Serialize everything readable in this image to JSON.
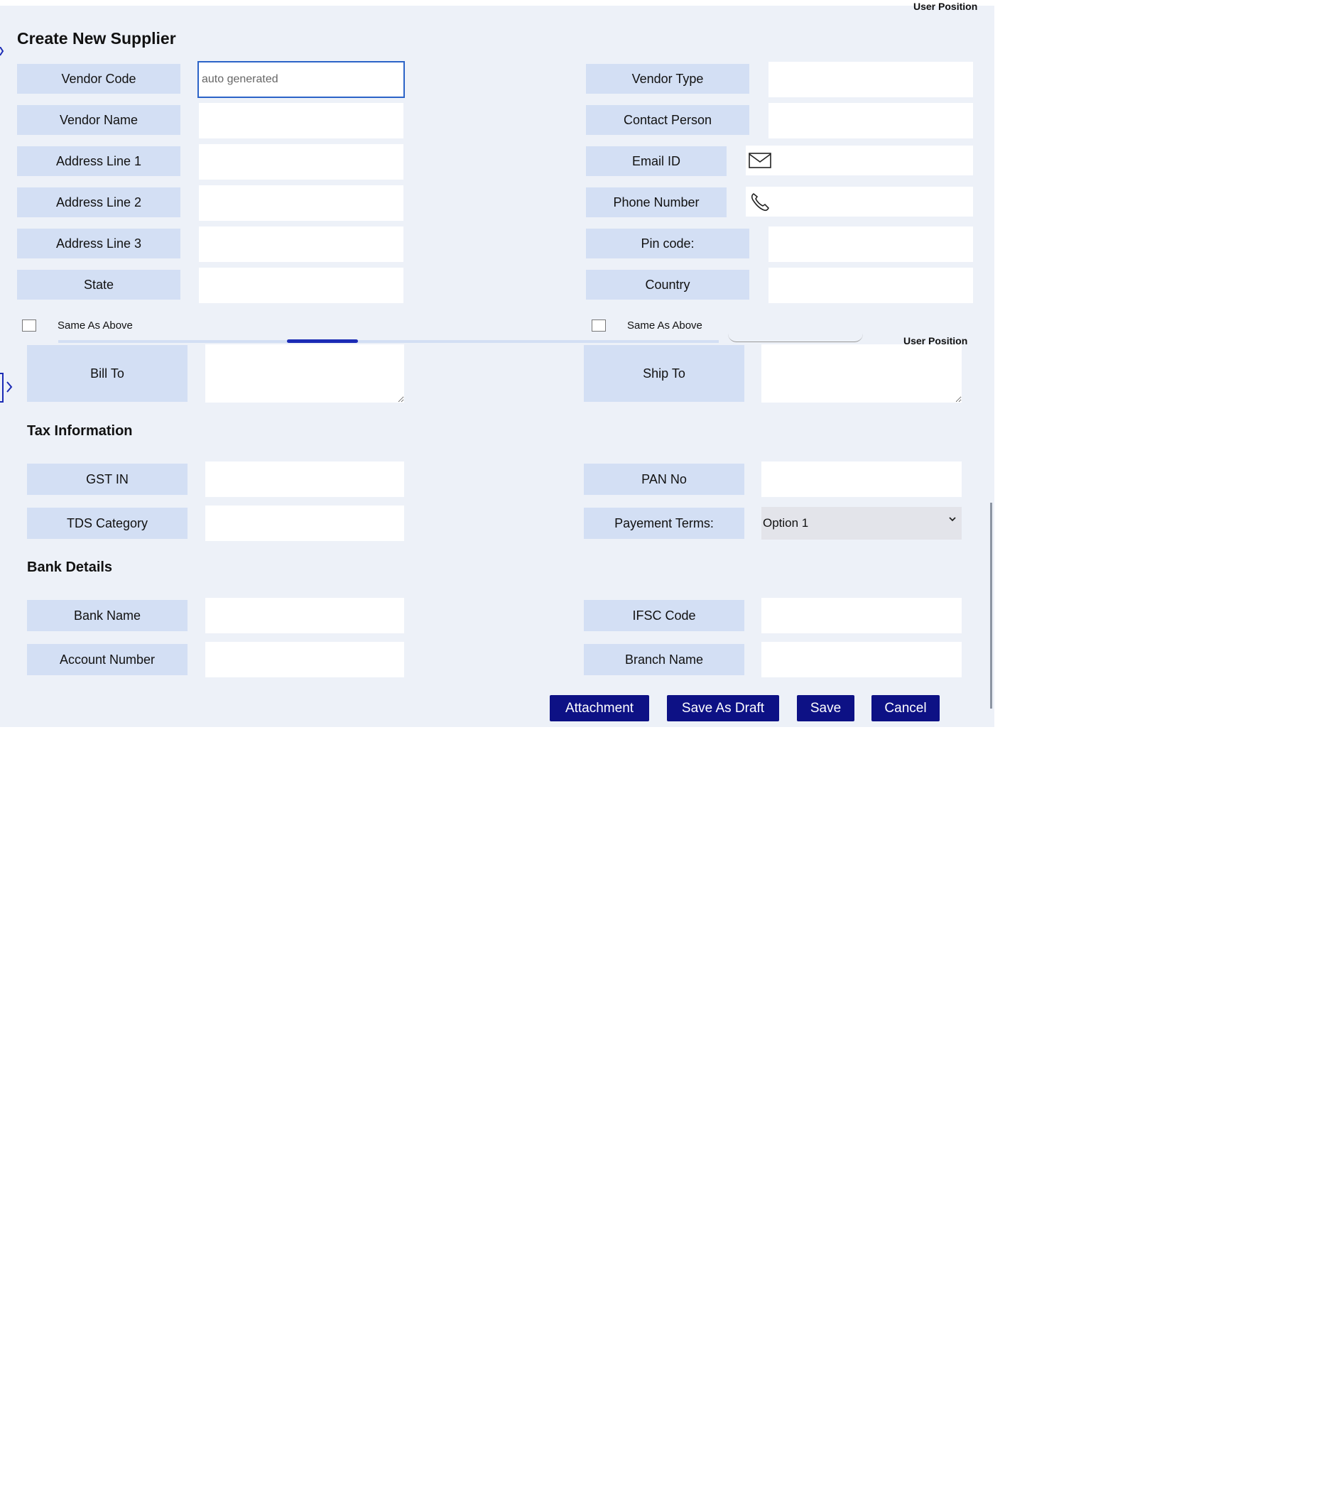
{
  "header": {
    "title": "Create New Supplier",
    "user_position_top": "User Position",
    "user_position_mid": "User Position"
  },
  "vendor": {
    "left": [
      {
        "label": "Vendor Code",
        "value": "",
        "placeholder": "auto generated"
      },
      {
        "label": "Vendor Name",
        "value": ""
      },
      {
        "label": "Address Line 1",
        "value": ""
      },
      {
        "label": "Address Line 2",
        "value": ""
      },
      {
        "label": "Address Line 3",
        "value": ""
      },
      {
        "label": "State",
        "value": ""
      }
    ],
    "right": [
      {
        "label": "Vendor Type",
        "value": ""
      },
      {
        "label": "Contact Person",
        "value": ""
      },
      {
        "label": "Email ID",
        "value": "",
        "icon": "mail-icon"
      },
      {
        "label": "Phone Number",
        "value": "",
        "icon": "phone-icon"
      },
      {
        "label": "Pin code:",
        "value": ""
      },
      {
        "label": "Country",
        "value": ""
      }
    ]
  },
  "same_as_above": {
    "left_label": "Same As Above",
    "right_label": "Same As Above",
    "left_checked": false,
    "right_checked": false
  },
  "address": {
    "bill_to_label": "Bill To",
    "ship_to_label": "Ship To",
    "bill_to_value": "",
    "ship_to_value": ""
  },
  "tax": {
    "title": "Tax Information",
    "gst_label": "GST IN",
    "pan_label": "PAN No",
    "tds_label": "TDS Category",
    "payment_terms_label": "Payement Terms:",
    "payment_terms_selected": "Option 1"
  },
  "bank": {
    "title": "Bank Details",
    "bank_name_label": "Bank Name",
    "ifsc_label": "IFSC Code",
    "account_number_label": "Account Number",
    "branch_name_label": "Branch Name"
  },
  "actions": {
    "attachment": "Attachment",
    "save_as_draft": "Save As Draft",
    "save": "Save",
    "cancel": "Cancel"
  },
  "colors": {
    "panel_bg": "#edf1f8",
    "label_bg": "#d3dff4",
    "button_bg": "#0d1185",
    "focus_border": "#2b63c7"
  }
}
